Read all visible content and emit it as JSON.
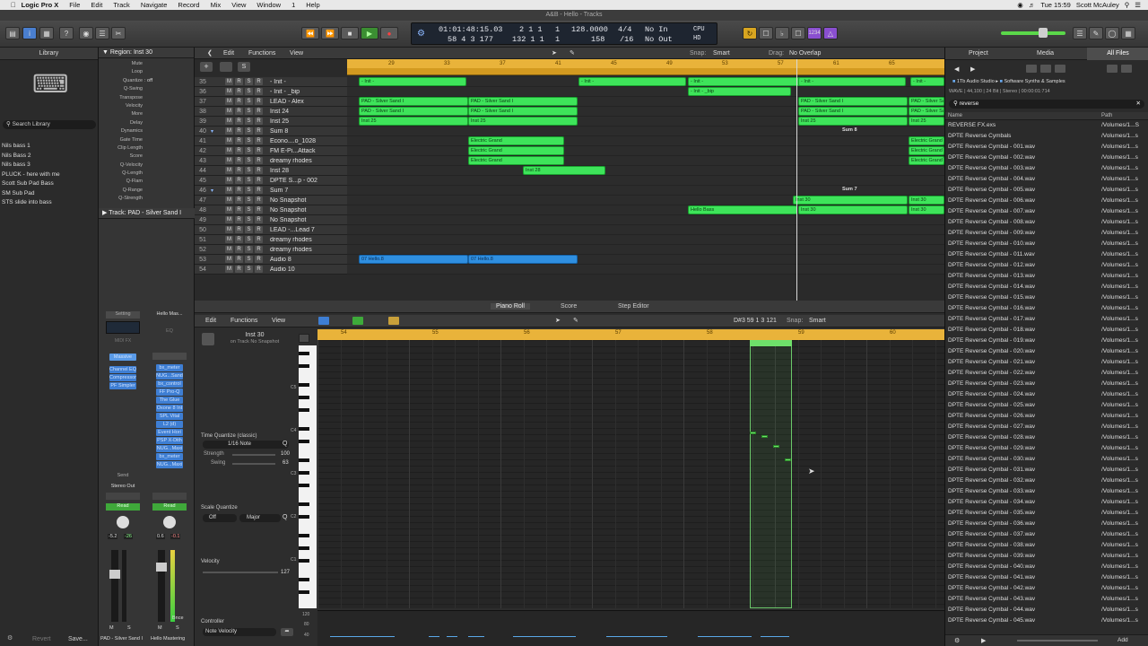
{
  "menubar": {
    "apple": "",
    "app": "Logic Pro X",
    "items": [
      "File",
      "Edit",
      "Track",
      "Navigate",
      "Record",
      "Mix",
      "View",
      "Window",
      "1",
      "Help"
    ],
    "clock": "Tue 15:59",
    "user": "Scott McAuley"
  },
  "window": {
    "title": "A&B - Hello - Tracks"
  },
  "transport": {
    "smpte": "01:01:48:15.03",
    "smpte_sub": "58 4 3 177",
    "bars": "2 1 1",
    "bars_sub": "132 1 1",
    "tick1": "1",
    "tick2": "1",
    "tempo": "128.0000",
    "tempo_sub": "158",
    "sig": "4/4",
    "sig_sub": "/16",
    "in": "No In",
    "out": "No Out",
    "cpu": "CPU",
    "hd": "HD"
  },
  "library": {
    "title": "Library",
    "search": "Search Library",
    "items": [
      "Nils bass 1",
      "Nils Bass 2",
      "Nils bass 3",
      "PLUCK - here with me",
      "Scott Sub Pad Bass",
      "SM Sub Pad",
      "STS slide into bass"
    ]
  },
  "inspector": {
    "region_label": "Region: Inst 30",
    "params": [
      [
        "Mute",
        ""
      ],
      [
        "Loop",
        ""
      ],
      [
        "Quantize",
        ": off"
      ],
      [
        "Q-Swing",
        ""
      ],
      [
        "Transpose",
        ""
      ],
      [
        "Velocity",
        ""
      ],
      [
        "More",
        ""
      ],
      [
        "Delay",
        ""
      ],
      [
        "Dynamics",
        ""
      ],
      [
        "Gate Time",
        ""
      ],
      [
        "Clip Length",
        ""
      ],
      [
        "Score",
        ""
      ],
      [
        "Q-Velocity",
        ""
      ],
      [
        "Q-Length",
        ""
      ],
      [
        "Q-Flam",
        ""
      ],
      [
        "Q-Range",
        ""
      ],
      [
        "Q-Strength",
        ""
      ]
    ],
    "track_label": "Track: PAD - Silver Sand I",
    "setting": "Setting",
    "hello": "Hello Mas...",
    "eq": "EQ",
    "midi_fx": "MIDI FX",
    "massive": "Massive",
    "plugins_a": [
      "Channel EQ",
      "Compressor",
      "PF Simpler"
    ],
    "plugins_b": [
      "bx_meter",
      "NUG...Sand",
      "bx_control",
      "FF Pro-Q",
      "The Glue",
      "Oxone 8 Int",
      "SPL Vital",
      "L2 (d)",
      "Event Hori",
      "PSP X-Dith",
      "NUG...Maxi",
      "bx_meter",
      "NUG...Maxi"
    ],
    "send": "Send",
    "stereo_out": "Stereo Out",
    "read1": "Read",
    "read2": "Read",
    "val1": "-5.2",
    "val2": "-26",
    "val3": "0.6",
    "val4": "-0.1",
    "bnce": "Bnce",
    "strip1": "PAD - Silver Sand I",
    "strip2": "Hello Mastering",
    "m": "M",
    "s": "S"
  },
  "tracks": {
    "edit": "Edit",
    "functions": "Functions",
    "view": "View",
    "snap_label": "Snap:",
    "snap": "Smart",
    "drag_label": "Drag:",
    "drag": "No Overlap",
    "ruler": [
      "29",
      "33",
      "37",
      "41",
      "45",
      "49",
      "53",
      "57",
      "61",
      "65"
    ],
    "rows": [
      [
        "35",
        "- Init -"
      ],
      [
        "36",
        "- Init - _bip"
      ],
      [
        "37",
        "LEAD - Alex"
      ],
      [
        "38",
        "Inst 24"
      ],
      [
        "39",
        "Inst 25"
      ],
      [
        "40",
        "Sum 8"
      ],
      [
        "41",
        "Econo....o_1028"
      ],
      [
        "42",
        "FM E-Pi...Attack"
      ],
      [
        "43",
        "dreamy rhodes"
      ],
      [
        "44",
        "Inst 28"
      ],
      [
        "45",
        "DPTE S...p - 002"
      ],
      [
        "46",
        "Sum 7"
      ],
      [
        "47",
        "No Snapshot"
      ],
      [
        "48",
        "No Snapshot"
      ],
      [
        "49",
        "No Snapshot"
      ],
      [
        "50",
        "LEAD -...Lead 7"
      ],
      [
        "51",
        "dreamy rhodes"
      ],
      [
        "52",
        "dreamy rhodes"
      ],
      [
        "53",
        "Audio 8"
      ],
      [
        "54",
        "Audio 10"
      ]
    ],
    "regions": {
      "init": "- Init -",
      "init_bip": "- Init - _bip",
      "pad": "PAD - Silver Sand I",
      "inst25": "Inst 25",
      "electric": "Electric Grand",
      "inst28": "Inst 28",
      "sum8": "Sum 8",
      "sum7": "Sum 7",
      "inst30": "Inst 30",
      "hello": "Hello Bass",
      "audio": "07 Hello.8"
    }
  },
  "editor": {
    "tabs": [
      "Piano Roll",
      "Score",
      "Step Editor"
    ],
    "edit": "Edit",
    "functions": "Functions",
    "view": "View",
    "pos": "D#3 59 1 3 121",
    "snap_label": "Snap:",
    "snap": "Smart",
    "region": "Inst 30",
    "region_sub": "on Track No Snapshot",
    "ruler": [
      "54",
      "55",
      "56",
      "57",
      "58",
      "59",
      "60"
    ],
    "keys": [
      "C5",
      "C4",
      "C3",
      "C2",
      "C1"
    ],
    "tq": "Time Quantize (classic)",
    "tq_val": "1/16 Note",
    "strength": "Strength",
    "strength_val": "100",
    "swing": "Swing",
    "swing_val": "63",
    "sq": "Scale Quantize",
    "sq_off": "Off",
    "sq_major": "Major",
    "velocity": "Velocity",
    "velocity_val": "127",
    "controller": "Controller",
    "note_velocity": "Note Velocity",
    "c_vals": [
      "120",
      "80",
      "40"
    ],
    "revert": "Revert",
    "save": "Save..."
  },
  "browser": {
    "tabs": [
      "Project",
      "Media",
      "All Files"
    ],
    "path1": "1Tb Audio Studio",
    "path2": "Software Synths & Samples",
    "info": "WAVE | 44,100 | 24 Bit | Stereo | 00:00:01:714",
    "search": "reverse",
    "col_name": "Name",
    "col_path": "Path",
    "files": [
      [
        "REVERSE FX.exs",
        "/Volumes/1...S"
      ],
      [
        "DPTE Reverse Cymbals",
        "/Volumes/1...s"
      ],
      [
        "DPTE Reverse Cymbal - 001.wav",
        "/Volumes/1...s"
      ],
      [
        "DPTE Reverse Cymbal - 002.wav",
        "/Volumes/1...s"
      ],
      [
        "DPTE Reverse Cymbal - 003.wav",
        "/Volumes/1...s"
      ],
      [
        "DPTE Reverse Cymbal - 004.wav",
        "/Volumes/1...s"
      ],
      [
        "DPTE Reverse Cymbal - 005.wav",
        "/Volumes/1...s"
      ],
      [
        "DPTE Reverse Cymbal - 006.wav",
        "/Volumes/1...s"
      ],
      [
        "DPTE Reverse Cymbal - 007.wav",
        "/Volumes/1...s"
      ],
      [
        "DPTE Reverse Cymbal - 008.wav",
        "/Volumes/1...s"
      ],
      [
        "DPTE Reverse Cymbal - 009.wav",
        "/Volumes/1...s"
      ],
      [
        "DPTE Reverse Cymbal - 010.wav",
        "/Volumes/1...s"
      ],
      [
        "DPTE Reverse Cymbal - 011.wav",
        "/Volumes/1...s"
      ],
      [
        "DPTE Reverse Cymbal - 012.wav",
        "/Volumes/1...s"
      ],
      [
        "DPTE Reverse Cymbal - 013.wav",
        "/Volumes/1...s"
      ],
      [
        "DPTE Reverse Cymbal - 014.wav",
        "/Volumes/1...s"
      ],
      [
        "DPTE Reverse Cymbal - 015.wav",
        "/Volumes/1...s"
      ],
      [
        "DPTE Reverse Cymbal - 016.wav",
        "/Volumes/1...s"
      ],
      [
        "DPTE Reverse Cymbal - 017.wav",
        "/Volumes/1...s"
      ],
      [
        "DPTE Reverse Cymbal - 018.wav",
        "/Volumes/1...s"
      ],
      [
        "DPTE Reverse Cymbal - 019.wav",
        "/Volumes/1...s"
      ],
      [
        "DPTE Reverse Cymbal - 020.wav",
        "/Volumes/1...s"
      ],
      [
        "DPTE Reverse Cymbal - 021.wav",
        "/Volumes/1...s"
      ],
      [
        "DPTE Reverse Cymbal - 022.wav",
        "/Volumes/1...s"
      ],
      [
        "DPTE Reverse Cymbal - 023.wav",
        "/Volumes/1...s"
      ],
      [
        "DPTE Reverse Cymbal - 024.wav",
        "/Volumes/1...s"
      ],
      [
        "DPTE Reverse Cymbal - 025.wav",
        "/Volumes/1...s"
      ],
      [
        "DPTE Reverse Cymbal - 026.wav",
        "/Volumes/1...s"
      ],
      [
        "DPTE Reverse Cymbal - 027.wav",
        "/Volumes/1...s"
      ],
      [
        "DPTE Reverse Cymbal - 028.wav",
        "/Volumes/1...s"
      ],
      [
        "DPTE Reverse Cymbal - 029.wav",
        "/Volumes/1...s"
      ],
      [
        "DPTE Reverse Cymbal - 030.wav",
        "/Volumes/1...s"
      ],
      [
        "DPTE Reverse Cymbal - 031.wav",
        "/Volumes/1...s"
      ],
      [
        "DPTE Reverse Cymbal - 032.wav",
        "/Volumes/1...s"
      ],
      [
        "DPTE Reverse Cymbal - 033.wav",
        "/Volumes/1...s"
      ],
      [
        "DPTE Reverse Cymbal - 034.wav",
        "/Volumes/1...s"
      ],
      [
        "DPTE Reverse Cymbal - 035.wav",
        "/Volumes/1...s"
      ],
      [
        "DPTE Reverse Cymbal - 036.wav",
        "/Volumes/1...s"
      ],
      [
        "DPTE Reverse Cymbal - 037.wav",
        "/Volumes/1...s"
      ],
      [
        "DPTE Reverse Cymbal - 038.wav",
        "/Volumes/1...s"
      ],
      [
        "DPTE Reverse Cymbal - 039.wav",
        "/Volumes/1...s"
      ],
      [
        "DPTE Reverse Cymbal - 040.wav",
        "/Volumes/1...s"
      ],
      [
        "DPTE Reverse Cymbal - 041.wav",
        "/Volumes/1...s"
      ],
      [
        "DPTE Reverse Cymbal - 042.wav",
        "/Volumes/1...s"
      ],
      [
        "DPTE Reverse Cymbal - 043.wav",
        "/Volumes/1...s"
      ],
      [
        "DPTE Reverse Cymbal - 044.wav",
        "/Volumes/1...s"
      ],
      [
        "DPTE Reverse Cymbal - 045.wav",
        "/Volumes/1...s"
      ]
    ],
    "add": "Add"
  }
}
